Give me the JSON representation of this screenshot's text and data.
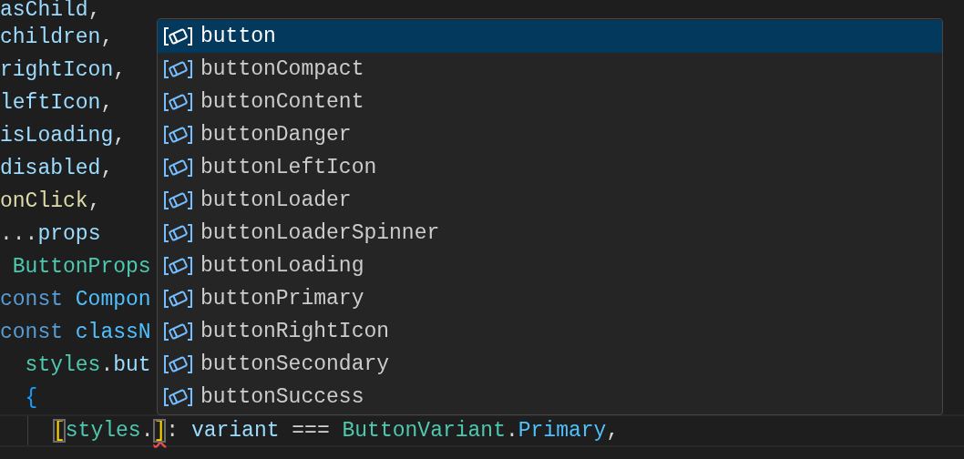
{
  "editor": {
    "lines": [
      {
        "tokens": [
          {
            "text": "asChild",
            "kind": "variable"
          },
          {
            "text": ",",
            "kind": "punctuation"
          }
        ]
      },
      {
        "tokens": [
          {
            "text": "children",
            "kind": "variable"
          },
          {
            "text": ",",
            "kind": "punctuation"
          }
        ]
      },
      {
        "tokens": [
          {
            "text": "rightIcon",
            "kind": "variable"
          },
          {
            "text": ",",
            "kind": "punctuation"
          }
        ]
      },
      {
        "tokens": [
          {
            "text": "leftIcon",
            "kind": "variable"
          },
          {
            "text": ",",
            "kind": "punctuation"
          }
        ]
      },
      {
        "tokens": [
          {
            "text": "isLoading",
            "kind": "variable"
          },
          {
            "text": ",",
            "kind": "punctuation"
          }
        ]
      },
      {
        "tokens": [
          {
            "text": "disabled",
            "kind": "variable"
          },
          {
            "text": ",",
            "kind": "punctuation"
          }
        ]
      },
      {
        "tokens": [
          {
            "text": "onClick",
            "kind": "function"
          },
          {
            "text": ",",
            "kind": "punctuation"
          }
        ]
      },
      {
        "tokens": [
          {
            "text": "...",
            "kind": "punctuation"
          },
          {
            "text": "props",
            "kind": "variable"
          }
        ]
      },
      {
        "tokens": [
          {
            "text": " ButtonProps",
            "kind": "type"
          }
        ]
      },
      {
        "tokens": [
          {
            "text": "const",
            "kind": "keyword"
          },
          {
            "text": " Compon",
            "kind": "constant"
          }
        ]
      },
      {
        "tokens": [
          {
            "text": "const",
            "kind": "keyword"
          },
          {
            "text": " classN",
            "kind": "constant"
          }
        ]
      },
      {
        "tokens": [
          {
            "text": "  styles",
            "kind": "type"
          },
          {
            "text": ".",
            "kind": "punctuation"
          },
          {
            "text": "but",
            "kind": "variable"
          }
        ]
      },
      {
        "tokens": [
          {
            "text": "  {",
            "kind": "brace"
          }
        ]
      },
      {
        "current": true,
        "indented": true,
        "tokens": [
          {
            "text": "[",
            "kind": "bracket"
          },
          {
            "text": "styles",
            "kind": "type"
          },
          {
            "text": ".",
            "kind": "punctuation"
          },
          {
            "text": "]",
            "kind": "bracket",
            "error": true
          },
          {
            "text": ": ",
            "kind": "punctuation"
          },
          {
            "text": "variant",
            "kind": "variable"
          },
          {
            "text": " === ",
            "kind": "punctuation"
          },
          {
            "text": "ButtonVariant",
            "kind": "type"
          },
          {
            "text": ".",
            "kind": "punctuation"
          },
          {
            "text": "Primary",
            "kind": "constant"
          },
          {
            "text": ",",
            "kind": "punctuation"
          }
        ]
      }
    ]
  },
  "suggestions": [
    {
      "label": "button",
      "selected": true
    },
    {
      "label": "buttonCompact",
      "selected": false
    },
    {
      "label": "buttonContent",
      "selected": false
    },
    {
      "label": "buttonDanger",
      "selected": false
    },
    {
      "label": "buttonLeftIcon",
      "selected": false
    },
    {
      "label": "buttonLoader",
      "selected": false
    },
    {
      "label": "buttonLoaderSpinner",
      "selected": false
    },
    {
      "label": "buttonLoading",
      "selected": false
    },
    {
      "label": "buttonPrimary",
      "selected": false
    },
    {
      "label": "buttonRightIcon",
      "selected": false
    },
    {
      "label": "buttonSecondary",
      "selected": false
    },
    {
      "label": "buttonSuccess",
      "selected": false
    }
  ]
}
